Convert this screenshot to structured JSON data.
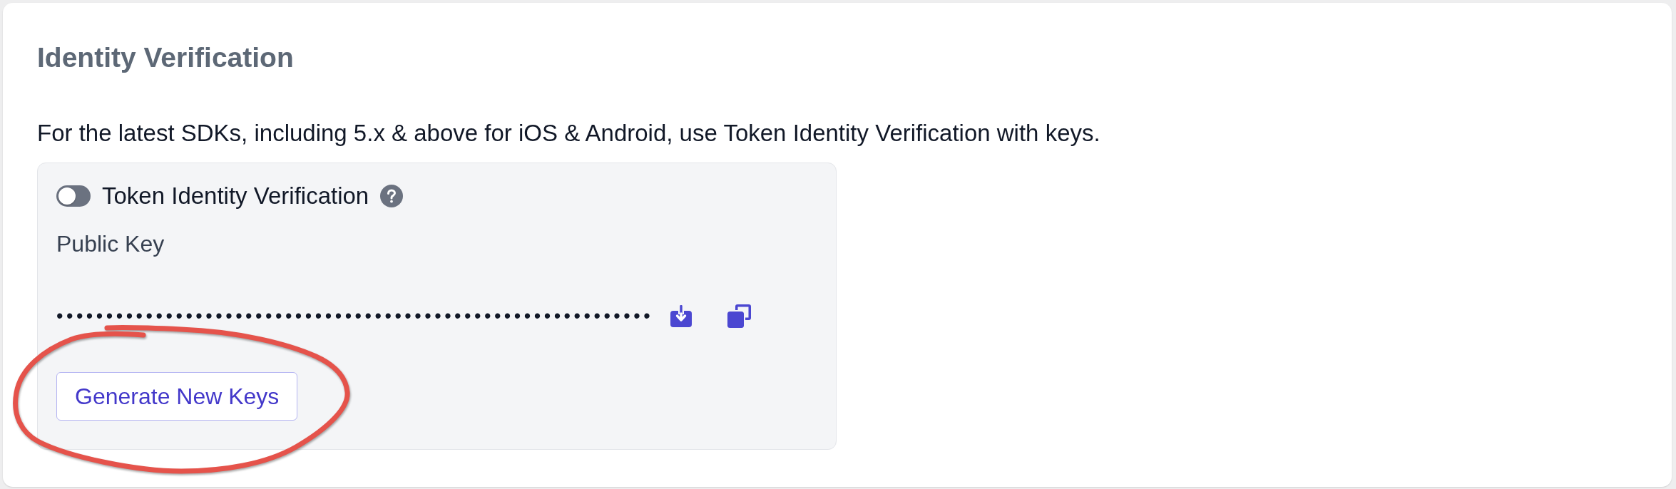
{
  "title": "Identity Verification",
  "description": "For the latest SDKs, including 5.x & above for iOS & Android, use Token Identity Verification with keys.",
  "token_panel": {
    "toggle": {
      "label": "Token Identity Verification",
      "on": false
    },
    "public_key": {
      "label": "Public Key",
      "value": "••••••••••••••••••••••••••••••••••••••••••••••••••••••••••••"
    },
    "generate_button": {
      "label": "Generate New Keys",
      "circled": true
    }
  }
}
